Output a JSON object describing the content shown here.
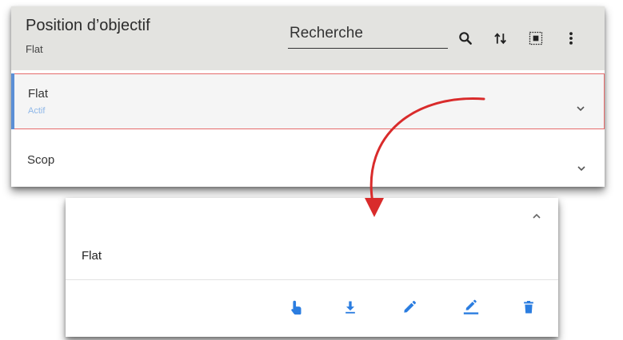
{
  "header": {
    "title": "Position d’objectif",
    "subtitle": "Flat",
    "search_placeholder": "Recherche"
  },
  "icons": {
    "search": "search-icon",
    "sort": "sort-icon",
    "select_all": "select-all-icon",
    "more": "more-vert-icon"
  },
  "list": {
    "items": [
      {
        "title": "Flat",
        "status": "Actif"
      },
      {
        "title": "Scop"
      }
    ]
  },
  "detail": {
    "title": "Flat",
    "actions": [
      "touch-icon",
      "download-icon",
      "edit-icon",
      "edit-underline-icon",
      "delete-icon"
    ]
  },
  "colors": {
    "toolbar_bg": "#e3e3e0",
    "accent_blue": "#2b7de0",
    "selected_border": "#e56b6b",
    "selected_bar": "#5b8fd6",
    "status_text": "#8eb7e8",
    "arrow": "#d92b2b"
  }
}
